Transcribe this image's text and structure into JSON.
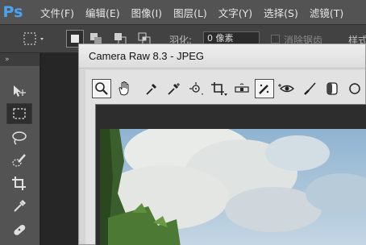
{
  "app": {
    "logo_text": "Ps"
  },
  "menu": {
    "items": [
      {
        "label": "文件(F)"
      },
      {
        "label": "编辑(E)"
      },
      {
        "label": "图像(I)"
      },
      {
        "label": "图层(L)"
      },
      {
        "label": "文字(Y)"
      },
      {
        "label": "选择(S)"
      },
      {
        "label": "滤镜(T)"
      }
    ]
  },
  "options_bar": {
    "feather_label": "羽化:",
    "feather_value": "0 像素",
    "antialias_label": "消除锯齿",
    "style_label": "样式:"
  },
  "tools_panel": {
    "collapse_glyph": "»"
  },
  "camera_raw": {
    "title": "Camera Raw 8.3  -  JPEG"
  },
  "colors": {
    "accent": "#4aa3f0",
    "chrome_dark": "#535353",
    "dialog_bg": "#d6d6d6"
  }
}
